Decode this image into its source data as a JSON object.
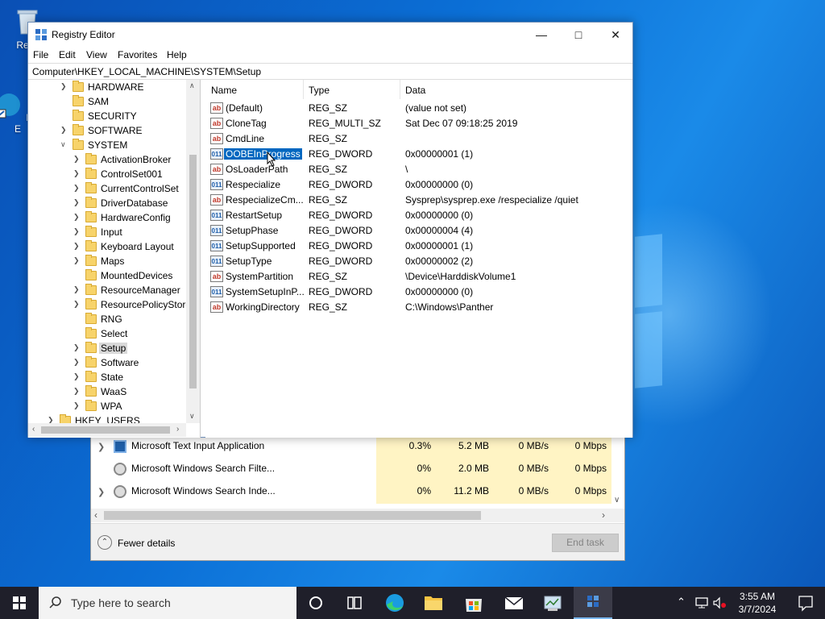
{
  "desktop": {
    "icons": [
      {
        "label": "Recy"
      },
      {
        "label": "Mic\nE"
      }
    ]
  },
  "regedit": {
    "title": "Registry Editor",
    "menu": [
      "File",
      "Edit",
      "View",
      "Favorites",
      "Help"
    ],
    "address": "Computer\\HKEY_LOCAL_MACHINE\\SYSTEM\\Setup",
    "tree": [
      {
        "label": "HARDWARE"
      },
      {
        "label": "SAM"
      },
      {
        "label": "SECURITY"
      },
      {
        "label": "SOFTWARE"
      },
      {
        "label": "SYSTEM"
      },
      {
        "label": "ActivationBroker"
      },
      {
        "label": "ControlSet001"
      },
      {
        "label": "CurrentControlSet"
      },
      {
        "label": "DriverDatabase"
      },
      {
        "label": "HardwareConfig"
      },
      {
        "label": "Input"
      },
      {
        "label": "Keyboard Layout"
      },
      {
        "label": "Maps"
      },
      {
        "label": "MountedDevices"
      },
      {
        "label": "ResourceManager"
      },
      {
        "label": "ResourcePolicyStore"
      },
      {
        "label": "RNG"
      },
      {
        "label": "Select"
      },
      {
        "label": "Setup"
      },
      {
        "label": "Software"
      },
      {
        "label": "State"
      },
      {
        "label": "WaaS"
      },
      {
        "label": "WPA"
      },
      {
        "label": "HKEY_USERS"
      }
    ],
    "columns": {
      "name": "Name",
      "type": "Type",
      "data": "Data"
    },
    "values": [
      {
        "name": "(Default)",
        "type": "REG_SZ",
        "data": "(value not set)",
        "icon": "string-value-icon"
      },
      {
        "name": "CloneTag",
        "type": "REG_MULTI_SZ",
        "data": "Sat Dec 07 09:18:25 2019",
        "icon": "string-value-icon"
      },
      {
        "name": "CmdLine",
        "type": "REG_SZ",
        "data": "",
        "icon": "string-value-icon"
      },
      {
        "name": "OOBEInProgress",
        "type": "REG_DWORD",
        "data": "0x00000001 (1)",
        "icon": "binary-value-icon"
      },
      {
        "name": "OsLoaderPath",
        "type": "REG_SZ",
        "data": "\\",
        "icon": "string-value-icon"
      },
      {
        "name": "Respecialize",
        "type": "REG_DWORD",
        "data": "0x00000000 (0)",
        "icon": "binary-value-icon"
      },
      {
        "name": "RespecializeCm...",
        "type": "REG_SZ",
        "data": "Sysprep\\sysprep.exe /respecialize /quiet",
        "icon": "string-value-icon"
      },
      {
        "name": "RestartSetup",
        "type": "REG_DWORD",
        "data": "0x00000000 (0)",
        "icon": "binary-value-icon"
      },
      {
        "name": "SetupPhase",
        "type": "REG_DWORD",
        "data": "0x00000004 (4)",
        "icon": "binary-value-icon"
      },
      {
        "name": "SetupSupported",
        "type": "REG_DWORD",
        "data": "0x00000001 (1)",
        "icon": "binary-value-icon"
      },
      {
        "name": "SetupType",
        "type": "REG_DWORD",
        "data": "0x00000002 (2)",
        "icon": "binary-value-icon"
      },
      {
        "name": "SystemPartition",
        "type": "REG_SZ",
        "data": "\\Device\\HarddiskVolume1",
        "icon": "string-value-icon"
      },
      {
        "name": "SystemSetupInP...",
        "type": "REG_DWORD",
        "data": "0x00000000 (0)",
        "icon": "binary-value-icon"
      },
      {
        "name": "WorkingDirectory",
        "type": "REG_SZ",
        "data": "C:\\Windows\\Panther",
        "icon": "string-value-icon"
      }
    ],
    "selected_value": "OOBEInProgress",
    "icon_glyphs": {
      "string": "ab",
      "binary": "011"
    }
  },
  "taskmgr": {
    "rows": [
      {
        "name": "Microsoft Text Input Application",
        "cpu": "0.3%",
        "memory": "5.2 MB",
        "disk": "0 MB/s",
        "network": "0 Mbps"
      },
      {
        "name": "Microsoft Windows Search Filte...",
        "cpu": "0%",
        "memory": "2.0 MB",
        "disk": "0 MB/s",
        "network": "0 Mbps"
      },
      {
        "name": "Microsoft Windows Search Inde...",
        "cpu": "0%",
        "memory": "11.2 MB",
        "disk": "0 MB/s",
        "network": "0 Mbps"
      }
    ],
    "fewer_details": "Fewer details",
    "end_task": "End task"
  },
  "taskbar": {
    "search_placeholder": "Type here to search",
    "time": "3:55 AM",
    "date": "3/7/2024"
  },
  "colors": {
    "selection": "#0067c0",
    "desktop": "#0b6fd6",
    "taskbar": "#1f1f2a",
    "taskmgr_highlight": "#fff4c4"
  }
}
